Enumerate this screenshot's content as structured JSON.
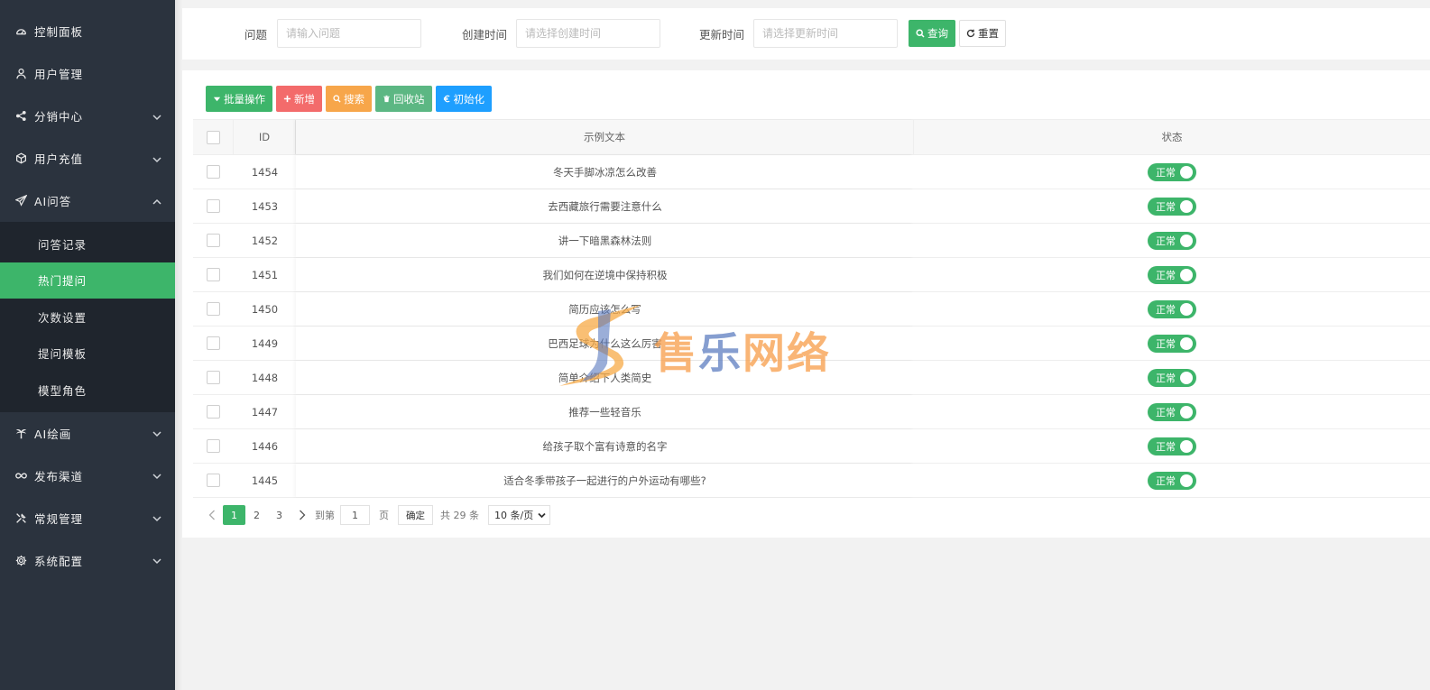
{
  "sidebar": {
    "items_top": [
      {
        "label": "控制面板",
        "icon": "dashboard-icon",
        "has_chevron": false
      },
      {
        "label": "用户管理",
        "icon": "user-icon",
        "has_chevron": false
      },
      {
        "label": "分销中心",
        "icon": "share-icon",
        "has_chevron": true
      },
      {
        "label": "用户充值",
        "icon": "cube-icon",
        "has_chevron": true
      },
      {
        "label": "AI问答",
        "icon": "paper-plane-icon",
        "has_chevron": true,
        "expanded": true
      }
    ],
    "sub_items": [
      {
        "label": "问答记录",
        "active": false
      },
      {
        "label": "热门提问",
        "active": true
      },
      {
        "label": "次数设置",
        "active": false
      },
      {
        "label": "提问模板",
        "active": false
      },
      {
        "label": "模型角色",
        "active": false
      }
    ],
    "items_bottom": [
      {
        "label": "AI绘画",
        "icon": "palm-icon",
        "has_chevron": true
      },
      {
        "label": "发布渠道",
        "icon": "infinity-icon",
        "has_chevron": true
      },
      {
        "label": "常规管理",
        "icon": "tools-icon",
        "has_chevron": true
      },
      {
        "label": "系统配置",
        "icon": "gear-icon",
        "has_chevron": true
      }
    ],
    "bg_color": "#2b333e",
    "active_color": "#3db56a"
  },
  "filter": {
    "question_label": "问题",
    "question_placeholder": "请输入问题",
    "created_label": "创建时间",
    "created_placeholder": "请选择创建时间",
    "updated_label": "更新时间",
    "updated_placeholder": "请选择更新时间",
    "query_button": "查询",
    "reset_button": "重置"
  },
  "toolbar": {
    "batch": "批量操作",
    "add": "新增",
    "search": "搜索",
    "recycle": "回收站",
    "init": "初始化"
  },
  "table": {
    "headers": {
      "id": "ID",
      "text": "示例文本",
      "status": "状态"
    },
    "rows": [
      {
        "id": "1454",
        "text": "冬天手脚冰凉怎么改善",
        "status": "正常"
      },
      {
        "id": "1453",
        "text": "去西藏旅行需要注意什么",
        "status": "正常"
      },
      {
        "id": "1452",
        "text": "讲一下暗黑森林法则",
        "status": "正常"
      },
      {
        "id": "1451",
        "text": "我们如何在逆境中保持积极",
        "status": "正常"
      },
      {
        "id": "1450",
        "text": "简历应该怎么写",
        "status": "正常"
      },
      {
        "id": "1449",
        "text": "巴西足球为什么这么厉害",
        "status": "正常"
      },
      {
        "id": "1448",
        "text": "简单介绍下人类简史",
        "status": "正常"
      },
      {
        "id": "1447",
        "text": "推荐一些轻音乐",
        "status": "正常"
      },
      {
        "id": "1446",
        "text": "给孩子取个富有诗意的名字",
        "status": "正常"
      },
      {
        "id": "1445",
        "text": "适合冬季带孩子一起进行的户外运动有哪些?",
        "status": "正常"
      }
    ]
  },
  "pager": {
    "pages": [
      "1",
      "2",
      "3"
    ],
    "current": "1",
    "goto_label": "到第",
    "goto_value": "1",
    "page_unit": "页",
    "confirm": "确定",
    "total": "共 29 条",
    "page_size": "10 条/页"
  },
  "watermark": {
    "c1": "售",
    "c2": "乐",
    "c3": "网络"
  }
}
